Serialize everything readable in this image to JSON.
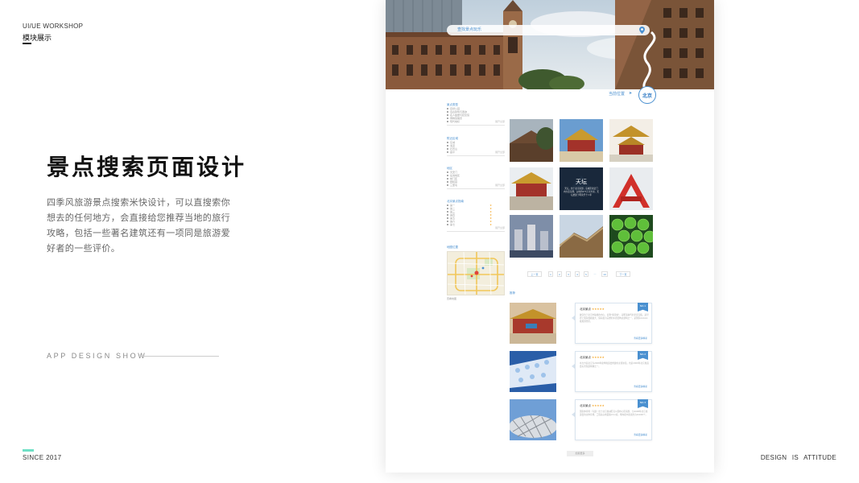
{
  "presentation": {
    "workshop_label": "UI/UE WORKSHOP",
    "workshop_sub": "模块展示",
    "title": "景点搜索页面设计",
    "description_lines": [
      "四季风旅游景点搜索米快设计，可以直搜索你",
      "想去的任何地方，会直接给您推荐当地的旅行",
      "攻略，包括一些著名建筑还有一项同是旅游爱",
      "好者的一些评价。"
    ],
    "show_label": "APP DESIGN SHOW",
    "since": "SINCE  2017",
    "attitude": "DESIGN  IS  ATTITUDE",
    "accent_color": "#6fe0c6"
  },
  "mockup": {
    "search": {
      "placeholder": "查找景点玩乐",
      "icon": "location-pin-icon"
    },
    "location": {
      "label": "当前位置",
      "arrow": "➤",
      "city": "北京"
    },
    "accent_color": "#4a90d0",
    "sidebar": {
      "groups": [
        {
          "title": "景点类型",
          "items": [
            "自然公园",
            "远古建筑与遗迹",
            "名人故居与纪念馆",
            "博物馆展览",
            "现代地标"
          ],
          "more": "展开全部"
        },
        {
          "title": "附近区域",
          "items": [
            "东城",
            "海淀",
            "石景山",
            "昌平"
          ],
          "more": "展开全部"
        },
        {
          "title": "地区",
          "items": [
            "天安门",
            "后海地区",
            "前门区",
            "颐和园",
            "三里屯"
          ],
          "more": "展开全部"
        },
        {
          "title": "北京景点指南",
          "items": [
            "第一",
            "第二",
            "第三",
            "第四",
            "第五",
            "第六",
            "第七"
          ],
          "more": "展开全部"
        }
      ],
      "map_title": "地图位置",
      "map_caption": "查看地图"
    },
    "featured_tile": {
      "title": "天坛",
      "description": "天坛，位于北京南部，东城区永定门内大街东侧。占地约273万平方米。天坛始建于明永乐十八年"
    },
    "pager": {
      "prev": "上一页",
      "pages": [
        "1",
        "2",
        "3",
        "4",
        "5",
        "…",
        "10"
      ],
      "next": "下一页"
    },
    "reviews_title": "推荐",
    "reviews": [
      {
        "name": "北京景点",
        "stars": "★★★★★",
        "badge": "NO.1",
        "body": "故宫位于北京中轴线的中心，旧称“紫禁城”，是明清两代的皇家宫殿，是世界上现存规模最大、保存最为完整的木质结构古建筑之一，是国家AAAAA级旅游景区。",
        "more": "查看更多精彩"
      },
      {
        "name": "北京景点",
        "stars": "★★★★★",
        "badge": "NO.2",
        "body": "水立方是北京为2008年夏季奥运会修建的主游泳馆，也是2008年北京奥运会标志性建筑物之一。",
        "more": "查看更多精彩"
      },
      {
        "name": "北京景点",
        "stars": "★★★★★",
        "badge": "NO.3",
        "body": "国家体育场（鸟巢）位于北京奥林匹克公园中心区南部，为2008年北京奥运会的主体育场，工程总占地面积21公顷，场内观众座席约为91000个。",
        "more": "查看更多精彩"
      }
    ],
    "load_more": "加载更多"
  }
}
